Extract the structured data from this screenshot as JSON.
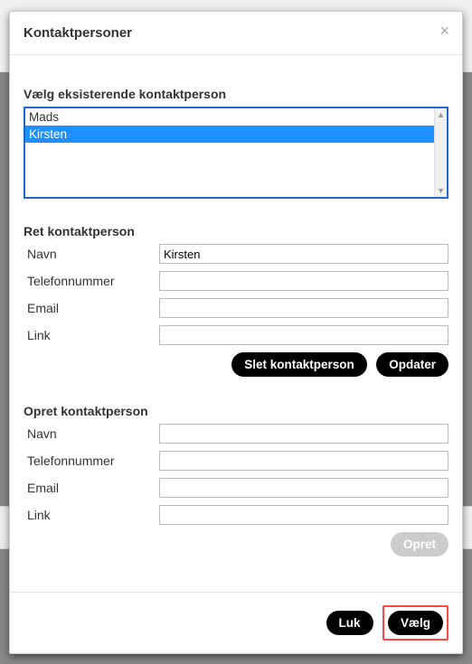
{
  "header": {
    "title": "Kontaktpersoner",
    "close_glyph": "×"
  },
  "select_section": {
    "label": "Vælg eksisterende kontaktperson",
    "options": [
      "Mads",
      "Kirsten"
    ],
    "selected_index": 1
  },
  "edit_section": {
    "label": "Ret kontaktperson",
    "fields": {
      "name": {
        "label": "Navn",
        "value": "Kirsten"
      },
      "phone": {
        "label": "Telefonnummer",
        "value": ""
      },
      "email": {
        "label": "Email",
        "value": ""
      },
      "link": {
        "label": "Link",
        "value": ""
      }
    },
    "buttons": {
      "delete": "Slet kontaktperson",
      "update": "Opdater"
    }
  },
  "create_section": {
    "label": "Opret kontaktperson",
    "fields": {
      "name": {
        "label": "Navn",
        "value": ""
      },
      "phone": {
        "label": "Telefonnummer",
        "value": ""
      },
      "email": {
        "label": "Email",
        "value": ""
      },
      "link": {
        "label": "Link",
        "value": ""
      }
    },
    "buttons": {
      "create": "Opret"
    }
  },
  "footer": {
    "close": "Luk",
    "select": "Vælg"
  }
}
